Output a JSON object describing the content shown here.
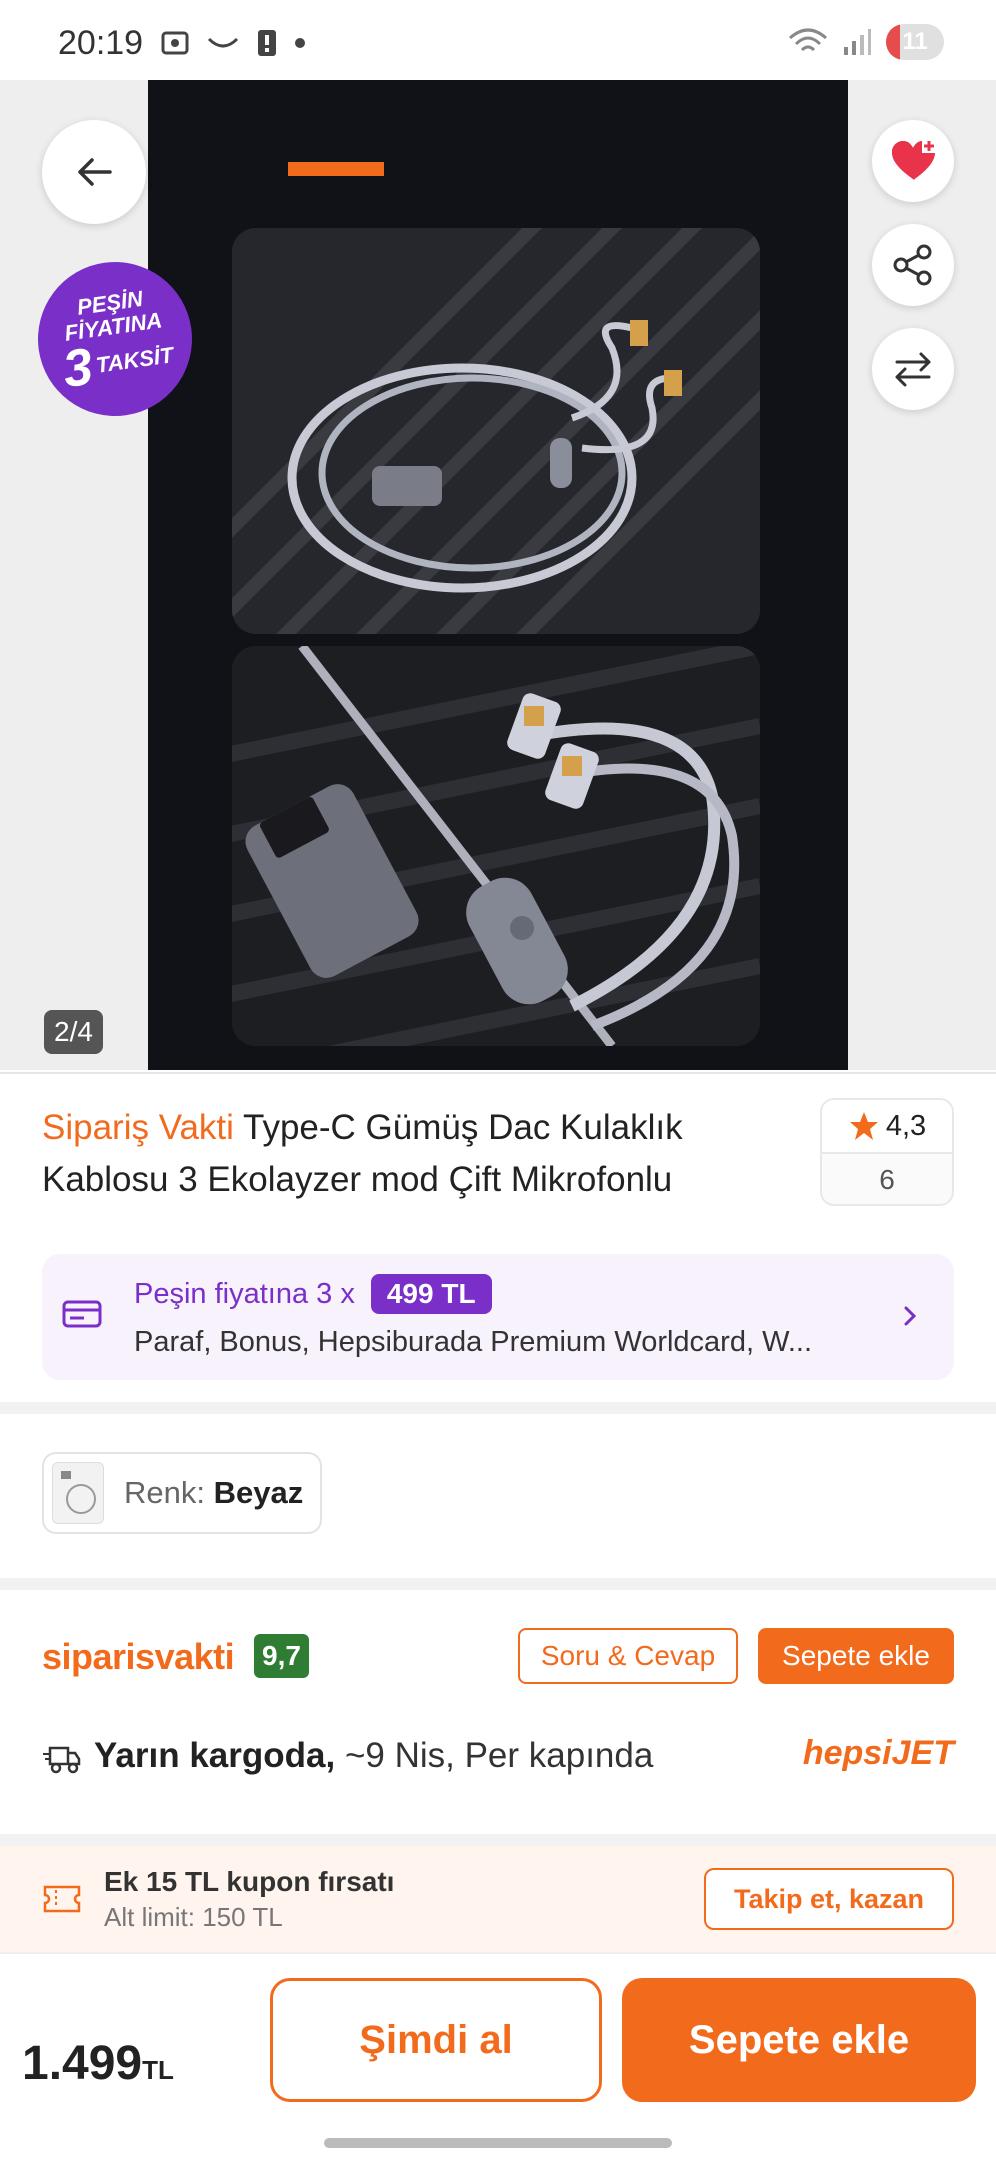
{
  "status_bar": {
    "time": "20:19",
    "battery": "11"
  },
  "gallery": {
    "page_indicator": "2/4",
    "promo_badge": {
      "line1": "PEŞİN",
      "line2": "FİYATINA",
      "line3_num": "3",
      "line3_word": "TAKSİT"
    }
  },
  "product": {
    "brand": "Sipariş Vakti",
    "title": " Type-C Gümüş Dac Kulaklık Kablosu 3 Ekolayzer mod Çift Mikrofonlu",
    "rating": "4,3",
    "rating_count": "6"
  },
  "installment": {
    "label": "Peşin fiyatına 3 x",
    "amount": "499 TL",
    "cards": "Paraf, Bonus, Hepsiburada Premium Worldcard, W..."
  },
  "variant": {
    "label": "Renk:",
    "value": "Beyaz"
  },
  "seller": {
    "name": "siparisvakti",
    "score": "9,7",
    "qa_label": "Soru & Cevap",
    "cart_label": "Sepete ekle"
  },
  "delivery": {
    "bold": "Yarın kargoda,",
    "rest": " ~9 Nis, Per kapında",
    "carrier_a": "hepsi",
    "carrier_b": "JET"
  },
  "coupon": {
    "title": "Ek 15 TL kupon fırsatı",
    "limit": "Alt limit: 150 TL",
    "button": "Takip et, kazan"
  },
  "bottom": {
    "price": "1.499",
    "currency": "TL",
    "buy_now": "Şimdi al",
    "add_to_cart": "Sepete ekle"
  },
  "colors": {
    "accent": "#f26b1d",
    "purple": "#7b2fc9",
    "score_green": "#2e7d32"
  }
}
